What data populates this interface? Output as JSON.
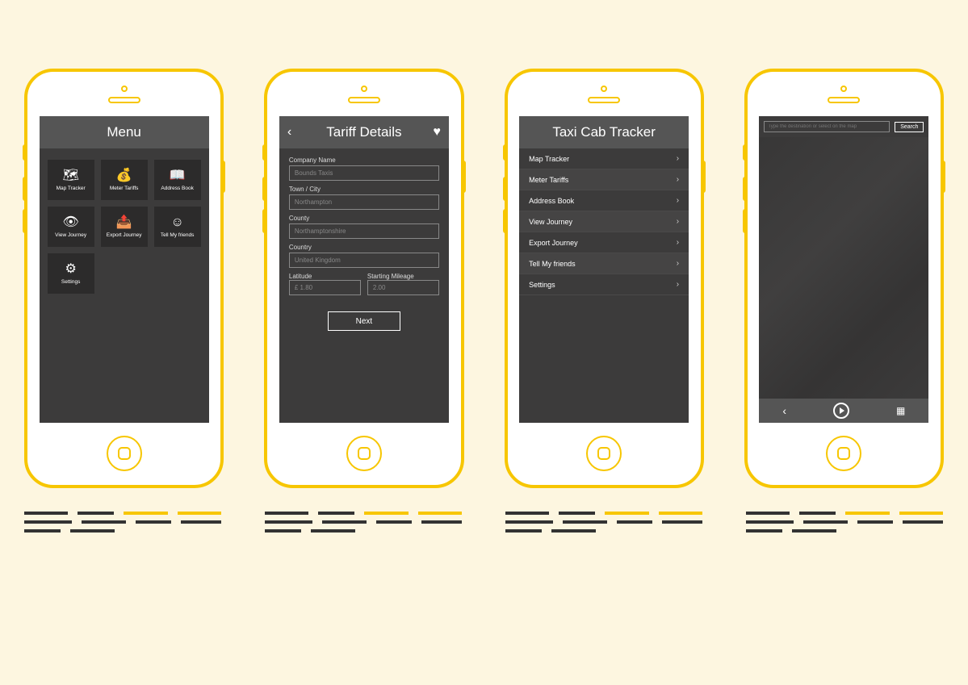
{
  "screen1": {
    "title": "Menu",
    "tiles": [
      {
        "label": "Map Tracker",
        "icon": "map-icon"
      },
      {
        "label": "Meter Tariffs",
        "icon": "dollar-icon"
      },
      {
        "label": "Address Book",
        "icon": "book-icon"
      },
      {
        "label": "View Journey",
        "icon": "eye-icon"
      },
      {
        "label": "Export Journey",
        "icon": "share-icon"
      },
      {
        "label": "Tell My friends",
        "icon": "smile-icon"
      },
      {
        "label": "Settings",
        "icon": "gear-icon"
      }
    ]
  },
  "screen2": {
    "title": "Tariff Details",
    "fields": {
      "company_label": "Company Name",
      "company_value": "Bounds Taxis",
      "town_label": "Town / City",
      "town_value": "Northampton",
      "county_label": "County",
      "county_value": "Northamptonshire",
      "country_label": "Country",
      "country_value": "United Kingdom",
      "lat_label": "Latitude",
      "lat_value": "£ 1.80",
      "mileage_label": "Starting Mileage",
      "mileage_value": "2.00"
    },
    "next_label": "Next"
  },
  "screen3": {
    "title": "Taxi Cab Tracker",
    "items": [
      {
        "label": "Map Tracker"
      },
      {
        "label": "Meter Tariffs"
      },
      {
        "label": "Address Book"
      },
      {
        "label": "View Journey"
      },
      {
        "label": "Export Journey"
      },
      {
        "label": "Tell My friends"
      },
      {
        "label": "Settings"
      }
    ]
  },
  "screen4": {
    "search_placeholder": "Type the destination or select on the map",
    "search_button": "Search"
  }
}
